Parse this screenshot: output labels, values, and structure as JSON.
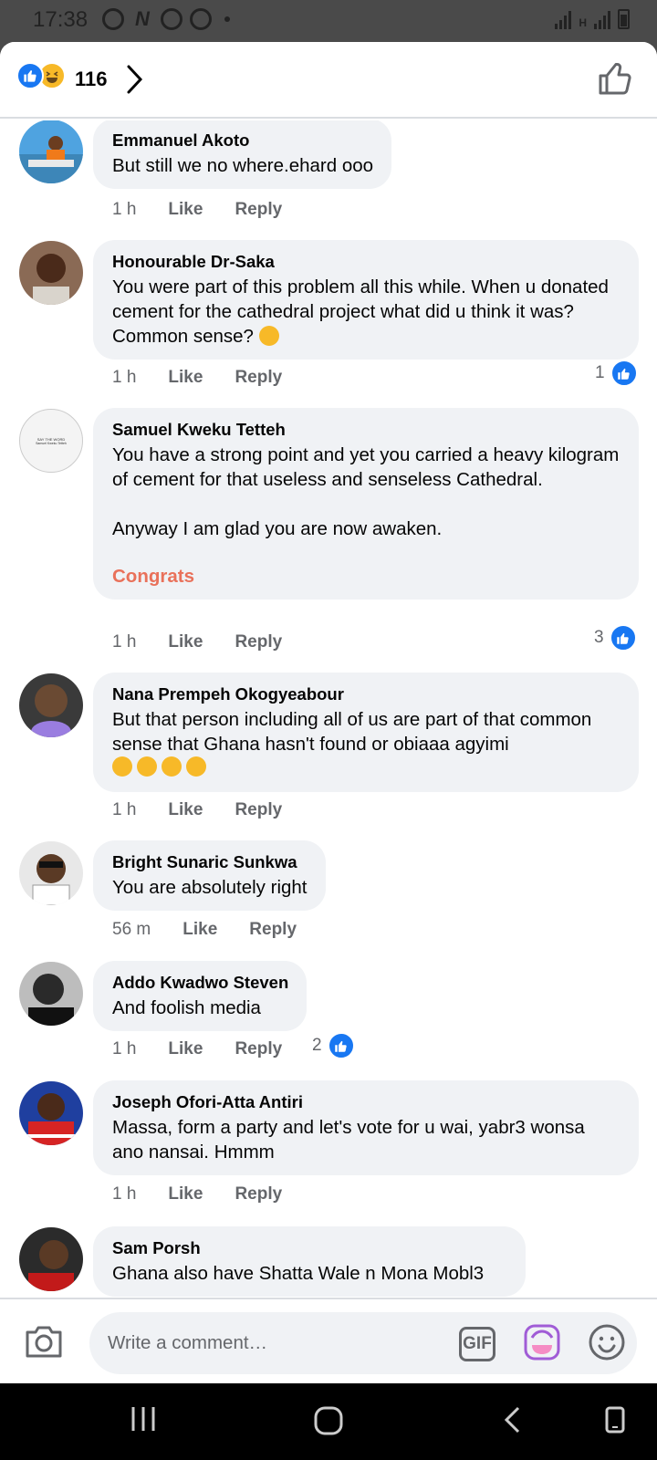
{
  "status_bar": {
    "time": "17:38",
    "network_label": "H"
  },
  "header": {
    "reaction_count": "116",
    "reactions": [
      "like-icon",
      "haha-icon"
    ]
  },
  "comments": [
    {
      "author": "Emmanuel Akoto",
      "text": "But still we no where.ehard ooo",
      "time": "1 h",
      "like": "Like",
      "reply": "Reply",
      "reactions": ""
    },
    {
      "author": "Honourable Dr-Saka",
      "text": "You were part of this problem all this while. When u donated cement for the cathedral project what did u think it was? Common sense?",
      "time": "1 h",
      "like": "Like",
      "reply": "Reply",
      "reactions": "1"
    },
    {
      "author": "Samuel Kweku Tetteh",
      "text": "You have a strong point and yet you carried a heavy kilogram of cement for that useless and senseless Cathedral.\n\nAnyway I am glad you are now awaken.",
      "link": "Congrats",
      "time": "1 h",
      "like": "Like",
      "reply": "Reply",
      "reactions": "3"
    },
    {
      "author": "Nana Prempeh Okogyeabour",
      "text": "But that person including all of us are part of that common sense that Ghana hasn't found or obiaaa agyimi",
      "time": "1 h",
      "like": "Like",
      "reply": "Reply",
      "reactions": ""
    },
    {
      "author": "Bright Sunaric Sunkwa",
      "text": "You are absolutely right",
      "time": "56 m",
      "like": "Like",
      "reply": "Reply",
      "reactions": ""
    },
    {
      "author": "Addo Kwadwo Steven",
      "text": "And foolish media",
      "time": "1 h",
      "like": "Like",
      "reply": "Reply",
      "reactions": "2"
    },
    {
      "author": "Joseph Ofori-Atta Antiri",
      "text": "Massa, form a party and let's vote for u wai, yabr3 wonsa ano nansai. Hmmm",
      "time": "1 h",
      "like": "Like",
      "reply": "Reply",
      "reactions": ""
    },
    {
      "author": "Sam Porsh",
      "text": "Ghana also have Shatta Wale n Mona Mobl3",
      "time": "",
      "like": "",
      "reply": "",
      "reactions": ""
    }
  ],
  "avatar_text": {
    "samuel_line1": "SAY THE WORD",
    "samuel_line2": "Samuel Kweku Tetteh"
  },
  "composer": {
    "placeholder": "Write a comment…",
    "gif_label": "GIF"
  },
  "colors": {
    "accent": "#1877f2",
    "link_orange": "#e9715a",
    "bubble": "#f0f2f5",
    "meta_gray": "#65676b"
  }
}
